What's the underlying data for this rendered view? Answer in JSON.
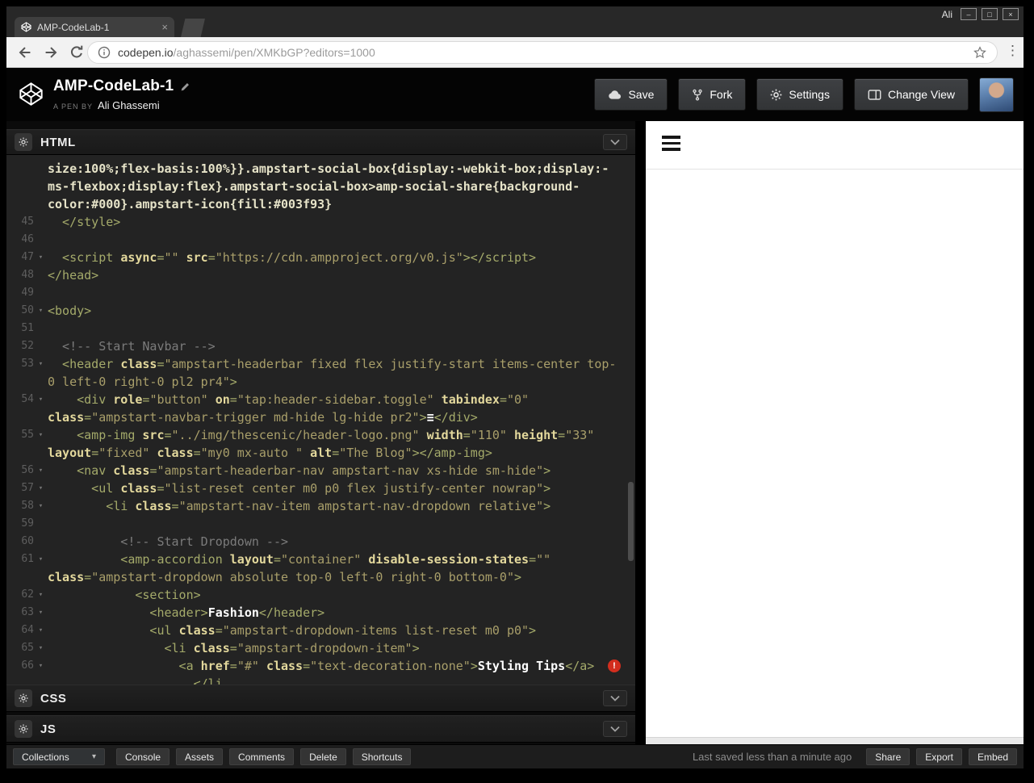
{
  "browser": {
    "window_user": "Ali",
    "tab_title": "AMP-CodeLab-1",
    "url": {
      "host": "codepen.io",
      "path": "/aghassemi/pen/XMKbGP?editors=1000"
    }
  },
  "pen_header": {
    "title": "AMP-CodeLab-1",
    "byline_label": "A PEN BY",
    "author": "Ali Ghassemi",
    "save_label": "Save",
    "fork_label": "Fork",
    "settings_label": "Settings",
    "change_view_label": "Change View"
  },
  "editors": {
    "html_label": "HTML",
    "css_label": "CSS",
    "js_label": "JS",
    "rows": [
      {
        "n": "",
        "s": [
          [
            "css",
            "size:100%;flex-basis:100%}}.ampstart-social-box{display:-webkit-box;display:-"
          ]
        ]
      },
      {
        "n": "",
        "s": [
          [
            "css",
            "ms-flexbox;display:flex}.ampstart-social-box>amp-social-share{background-"
          ]
        ]
      },
      {
        "n": "",
        "s": [
          [
            "css",
            "color:#000}.ampstart-icon{fill:#003f93}"
          ]
        ]
      },
      {
        "n": "45",
        "s": [
          [
            "t",
            "  </style>"
          ]
        ]
      },
      {
        "n": "46",
        "s": []
      },
      {
        "n": "47",
        "f": 1,
        "s": [
          [
            "t",
            "  <script "
          ],
          [
            "a",
            "async"
          ],
          [
            "t",
            "="
          ],
          [
            "str",
            "\"\""
          ],
          [
            "t",
            " "
          ],
          [
            "a",
            "src"
          ],
          [
            "t",
            "="
          ],
          [
            "str",
            "\"https://cdn.ampproject.org/v0.js\""
          ],
          [
            "t",
            "></script>"
          ]
        ]
      },
      {
        "n": "48",
        "s": [
          [
            "t",
            "</head>"
          ]
        ]
      },
      {
        "n": "49",
        "s": []
      },
      {
        "n": "50",
        "f": 1,
        "s": [
          [
            "t",
            "<body>"
          ]
        ]
      },
      {
        "n": "51",
        "s": []
      },
      {
        "n": "52",
        "s": [
          [
            "c",
            "  <!-- Start Navbar -->"
          ]
        ]
      },
      {
        "n": "53",
        "f": 1,
        "s": [
          [
            "t",
            "  <header "
          ],
          [
            "a",
            "class"
          ],
          [
            "t",
            "="
          ],
          [
            "str",
            "\"ampstart-headerbar fixed flex justify-start items-center top-"
          ]
        ]
      },
      {
        "n": "",
        "s": [
          [
            "str",
            "0 left-0 right-0 pl2 pr4\""
          ],
          [
            "t",
            ">"
          ]
        ]
      },
      {
        "n": "54",
        "f": 1,
        "s": [
          [
            "t",
            "    <div "
          ],
          [
            "a",
            "role"
          ],
          [
            "t",
            "="
          ],
          [
            "str",
            "\"button\""
          ],
          [
            "t",
            " "
          ],
          [
            "a",
            "on"
          ],
          [
            "t",
            "="
          ],
          [
            "str",
            "\"tap:header-sidebar.toggle\""
          ],
          [
            "t",
            " "
          ],
          [
            "a",
            "tabindex"
          ],
          [
            "t",
            "="
          ],
          [
            "str",
            "\"0\""
          ]
        ]
      },
      {
        "n": "",
        "s": [
          [
            "a",
            "class"
          ],
          [
            "t",
            "="
          ],
          [
            "str",
            "\"ampstart-navbar-trigger md-hide lg-hide pr2\""
          ],
          [
            "t",
            ">"
          ],
          [
            "x",
            "≡"
          ],
          [
            "t",
            "</div>"
          ]
        ]
      },
      {
        "n": "55",
        "f": 1,
        "s": [
          [
            "t",
            "    <amp-img "
          ],
          [
            "a",
            "src"
          ],
          [
            "t",
            "="
          ],
          [
            "str",
            "\"../img/thescenic/header-logo.png\""
          ],
          [
            "t",
            " "
          ],
          [
            "a",
            "width"
          ],
          [
            "t",
            "="
          ],
          [
            "str",
            "\"110\""
          ],
          [
            "t",
            " "
          ],
          [
            "a",
            "height"
          ],
          [
            "t",
            "="
          ],
          [
            "str",
            "\"33\""
          ]
        ]
      },
      {
        "n": "",
        "s": [
          [
            "a",
            "layout"
          ],
          [
            "t",
            "="
          ],
          [
            "str",
            "\"fixed\""
          ],
          [
            "t",
            " "
          ],
          [
            "a",
            "class"
          ],
          [
            "t",
            "="
          ],
          [
            "str",
            "\"my0 mx-auto \""
          ],
          [
            "t",
            " "
          ],
          [
            "a",
            "alt"
          ],
          [
            "t",
            "="
          ],
          [
            "str",
            "\"The Blog\""
          ],
          [
            "t",
            "></amp-img>"
          ]
        ]
      },
      {
        "n": "56",
        "f": 1,
        "s": [
          [
            "t",
            "    <nav "
          ],
          [
            "a",
            "class"
          ],
          [
            "t",
            "="
          ],
          [
            "str",
            "\"ampstart-headerbar-nav ampstart-nav xs-hide sm-hide\""
          ],
          [
            "t",
            ">"
          ]
        ]
      },
      {
        "n": "57",
        "f": 1,
        "s": [
          [
            "t",
            "      <ul "
          ],
          [
            "a",
            "class"
          ],
          [
            "t",
            "="
          ],
          [
            "str",
            "\"list-reset center m0 p0 flex justify-center nowrap\""
          ],
          [
            "t",
            ">"
          ]
        ]
      },
      {
        "n": "58",
        "f": 1,
        "s": [
          [
            "t",
            "        <li "
          ],
          [
            "a",
            "class"
          ],
          [
            "t",
            "="
          ],
          [
            "str",
            "\"ampstart-nav-item ampstart-nav-dropdown relative\""
          ],
          [
            "t",
            ">"
          ]
        ]
      },
      {
        "n": "59",
        "s": []
      },
      {
        "n": "60",
        "s": [
          [
            "c",
            "          <!-- Start Dropdown -->"
          ]
        ]
      },
      {
        "n": "61",
        "f": 1,
        "s": [
          [
            "t",
            "          <amp-accordion "
          ],
          [
            "a",
            "layout"
          ],
          [
            "t",
            "="
          ],
          [
            "str",
            "\"container\""
          ],
          [
            "t",
            " "
          ],
          [
            "a",
            "disable-session-states"
          ],
          [
            "t",
            "="
          ],
          [
            "str",
            "\"\""
          ]
        ]
      },
      {
        "n": "",
        "s": [
          [
            "a",
            "class"
          ],
          [
            "t",
            "="
          ],
          [
            "str",
            "\"ampstart-dropdown absolute top-0 left-0 right-0 bottom-0\""
          ],
          [
            "t",
            ">"
          ]
        ]
      },
      {
        "n": "62",
        "f": 1,
        "s": [
          [
            "t",
            "            <section>"
          ]
        ]
      },
      {
        "n": "63",
        "f": 1,
        "s": [
          [
            "t",
            "              <header>"
          ],
          [
            "x",
            "Fashion"
          ],
          [
            "t",
            "</header>"
          ]
        ]
      },
      {
        "n": "64",
        "f": 1,
        "s": [
          [
            "t",
            "              <ul "
          ],
          [
            "a",
            "class"
          ],
          [
            "t",
            "="
          ],
          [
            "str",
            "\"ampstart-dropdown-items list-reset m0 p0\""
          ],
          [
            "t",
            ">"
          ]
        ]
      },
      {
        "n": "65",
        "f": 1,
        "s": [
          [
            "t",
            "                <li "
          ],
          [
            "a",
            "class"
          ],
          [
            "t",
            "="
          ],
          [
            "str",
            "\"ampstart-dropdown-item\""
          ],
          [
            "t",
            ">"
          ]
        ]
      },
      {
        "n": "66",
        "f": 1,
        "err": 1,
        "s": [
          [
            "t",
            "                  <a "
          ],
          [
            "a",
            "href"
          ],
          [
            "t",
            "="
          ],
          [
            "str",
            "\"#\""
          ],
          [
            "t",
            " "
          ],
          [
            "a",
            "class"
          ],
          [
            "t",
            "="
          ],
          [
            "str",
            "\"text-decoration-none\""
          ],
          [
            "t",
            ">"
          ],
          [
            "x",
            "Styling Tips"
          ],
          [
            "t",
            "</a>"
          ]
        ]
      },
      {
        "n": "",
        "s": [
          [
            "t",
            "                    </li"
          ]
        ]
      }
    ]
  },
  "footer": {
    "collections_label": "Collections",
    "buttons": [
      "Console",
      "Assets",
      "Comments",
      "Delete",
      "Shortcuts"
    ],
    "saved_status": "Last saved less than a minute ago",
    "share_label": "Share",
    "export_label": "Export",
    "embed_label": "Embed"
  },
  "icons": {
    "minimize": "–",
    "maximize": "□",
    "close": "×",
    "tab_close": "×",
    "menu_dots": "⋮",
    "caret": "▾",
    "fold": "▾",
    "error": "!"
  },
  "colors": {
    "error_badge": "#d22e1e",
    "editor_background": "#232323",
    "header_background": "#040404",
    "token_tag": "#a4aa6a",
    "token_attr": "#e3d89c",
    "token_string": "#a99f6a",
    "token_comment": "#7b7b7b",
    "token_text": "#ffffff"
  }
}
